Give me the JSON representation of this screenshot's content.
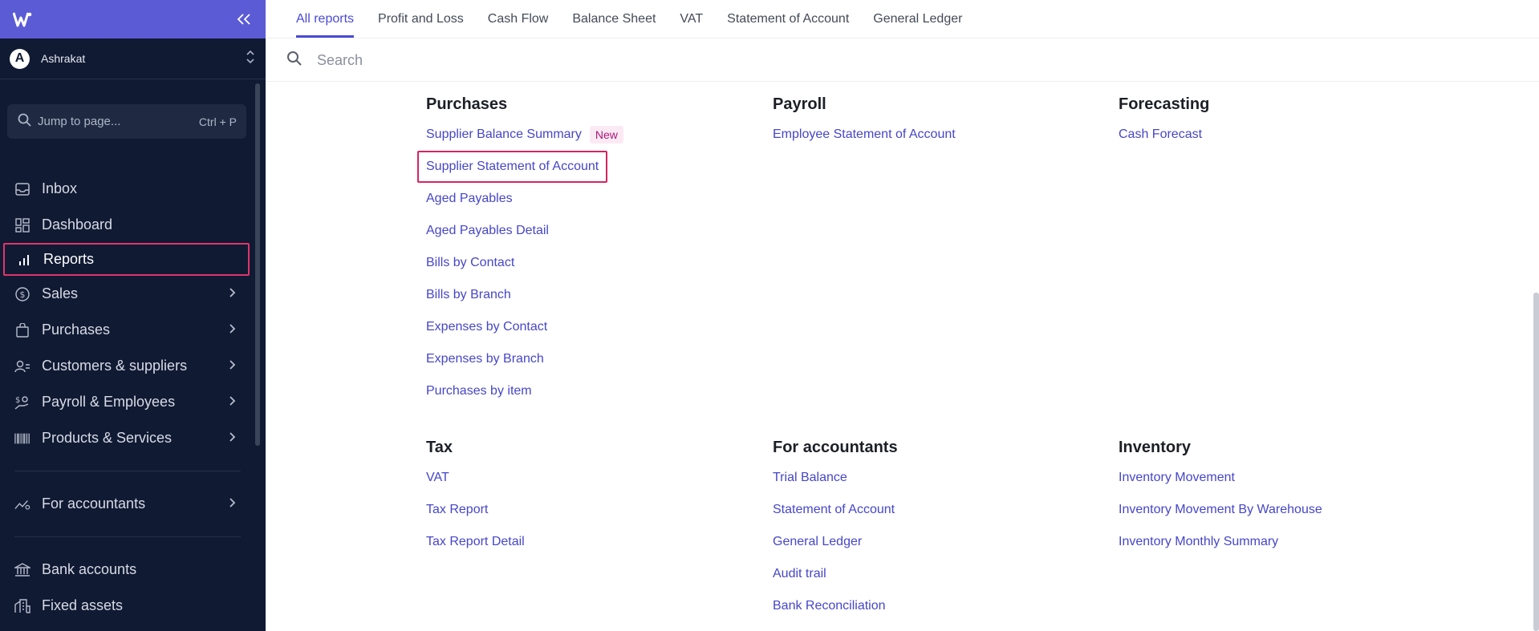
{
  "sidebar": {
    "org_initial": "A",
    "org_name": "Ashrakat",
    "jump_placeholder": "Jump to page...",
    "jump_shortcut": "Ctrl + P",
    "items": [
      {
        "label": "Inbox",
        "icon": "inbox-icon"
      },
      {
        "label": "Dashboard",
        "icon": "dashboard-icon"
      },
      {
        "label": "Reports",
        "icon": "bar-chart-icon",
        "active": true
      },
      {
        "label": "Sales",
        "icon": "dollar-circle-icon",
        "has_children": true
      },
      {
        "label": "Purchases",
        "icon": "shopping-bag-icon",
        "has_children": true
      },
      {
        "label": "Customers & suppliers",
        "icon": "users-icon",
        "has_children": true
      },
      {
        "label": "Payroll & Employees",
        "icon": "payroll-icon",
        "has_children": true
      },
      {
        "label": "Products & Services",
        "icon": "barcode-icon",
        "has_children": true
      },
      {
        "label": "For accountants",
        "icon": "trend-icon",
        "has_children": true
      },
      {
        "label": "Bank accounts",
        "icon": "bank-icon"
      },
      {
        "label": "Fixed assets",
        "icon": "building-icon"
      }
    ]
  },
  "tabs": [
    "All reports",
    "Profit and Loss",
    "Cash Flow",
    "Balance Sheet",
    "VAT",
    "Statement of Account",
    "General Ledger"
  ],
  "active_tab": "All reports",
  "search": {
    "placeholder": "Search"
  },
  "sections": {
    "purchases": {
      "title": "Purchases",
      "links": [
        "Supplier Balance Summary",
        "Supplier Statement of Account",
        "Aged Payables",
        "Aged Payables Detail",
        "Bills by Contact",
        "Bills by Branch",
        "Expenses by Contact",
        "Expenses by Branch",
        "Purchases by item"
      ],
      "new_badge": "New"
    },
    "payroll": {
      "title": "Payroll",
      "links": [
        "Employee Statement of Account"
      ]
    },
    "forecasting": {
      "title": "Forecasting",
      "links": [
        "Cash Forecast"
      ]
    },
    "tax": {
      "title": "Tax",
      "links": [
        "VAT",
        "Tax Report",
        "Tax Report Detail"
      ]
    },
    "accountants": {
      "title": "For accountants",
      "links": [
        "Trial Balance",
        "Statement of Account",
        "General Ledger",
        "Audit trail",
        "Bank Reconciliation"
      ]
    },
    "inventory": {
      "title": "Inventory",
      "links": [
        "Inventory Movement",
        "Inventory Movement By Warehouse",
        "Inventory Monthly Summary"
      ]
    }
  },
  "colors": {
    "accent": "#4a4ad4",
    "sidebar_bg": "#101a33",
    "brand": "#5b5bd6",
    "highlight": "#d6245f",
    "link": "#4646c8"
  }
}
